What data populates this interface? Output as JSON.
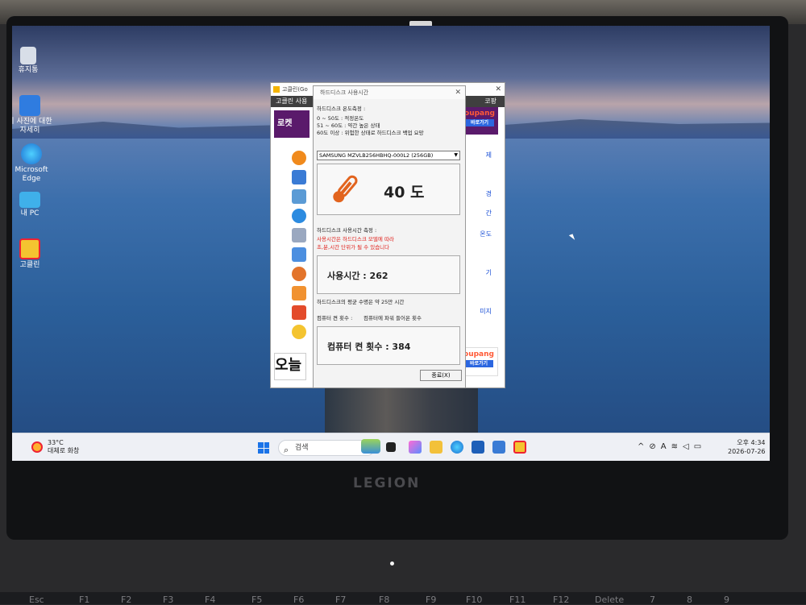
{
  "desktop_icons": [
    {
      "label": "휴지통"
    },
    {
      "label": "이 사진에 대한 자세히"
    },
    {
      "label": "Microsoft Edge"
    },
    {
      "label": "내 PC"
    },
    {
      "label": "고클린"
    }
  ],
  "back_window": {
    "title": "고클린(Go",
    "menu_left": "고클린 사용",
    "menu_right": "코팡",
    "rocket": "로켓",
    "coupang_brand": "oupang",
    "coupang_btn": "바로가기",
    "today": "오늘",
    "right_links": [
      "제",
      "경",
      "간",
      "온도",
      "",
      "기",
      "",
      "미지"
    ]
  },
  "dialog": {
    "title": "하드디스크 사용시간",
    "temp_header": "하드디스크 온도측정 :",
    "temp_lines": [
      "0 ~ 50도 : 적정온도",
      "51 ~ 60도 : 약간 높은 상태",
      "60도 이상 : 위험한 상태로 하드디스크 백업 요망"
    ],
    "drive": "SAMSUNG MZVLB256HBHQ-000L2 (256GB)",
    "temperature": "40 도",
    "usage_header": "하드디스크 사용시간 측정 :",
    "usage_note_1": "사용시간은 하드디스크 모델에 따라",
    "usage_note_2": "초,분,시간 단위가 될 수 있습니다",
    "usage_time": "사용시간 : 262",
    "avg_life": "하드디스크의 평균 수명은 약 25만 시간",
    "power_header": "컴퓨터 켠 횟수 :",
    "power_note": "컴퓨터에 파워 들어온 횟수",
    "power_count": "컴퓨터 켠 횟수 : 384",
    "exit_label": "종료(X)"
  },
  "taskbar": {
    "weather_temp": "33°C",
    "weather_desc": "대체로 화창",
    "search_placeholder": "검색",
    "tray_lang": "A",
    "time": "오후 4:34",
    "date": "2026-07-26"
  },
  "laptop": {
    "brand": "LEGION",
    "keys": [
      "Esc",
      "F1",
      "F2",
      "F3",
      "F4",
      "F5",
      "F6",
      "F7",
      "F8",
      "F9",
      "F10",
      "F11",
      "F12",
      "Delete",
      "7",
      "8",
      "9"
    ]
  },
  "colors": {
    "accent_red": "#e0211c",
    "link_blue": "#1a4fd6",
    "coupang_purple": "#5a1a6b"
  }
}
